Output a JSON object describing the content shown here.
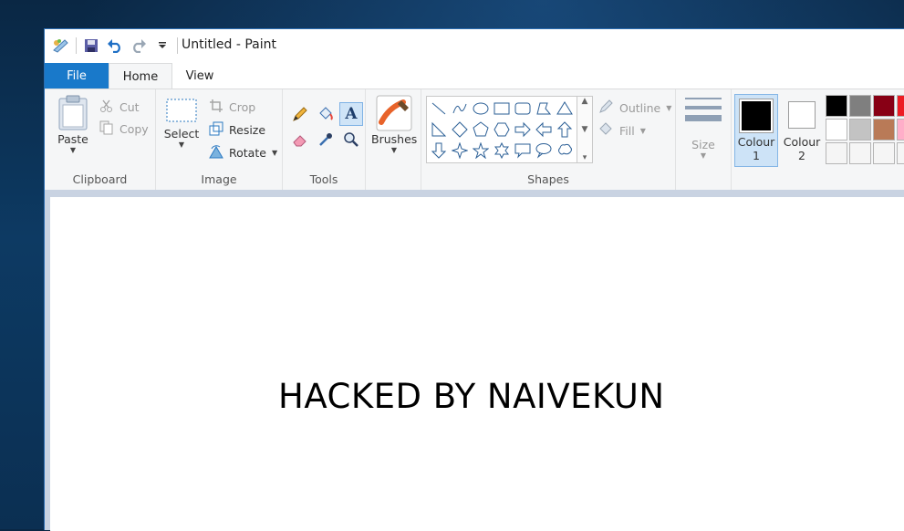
{
  "window": {
    "title": "Untitled - Paint"
  },
  "tabs": {
    "file": "File",
    "home": "Home",
    "view": "View"
  },
  "clipboard": {
    "paste": "Paste",
    "cut": "Cut",
    "copy": "Copy",
    "group": "Clipboard"
  },
  "image": {
    "select": "Select",
    "crop": "Crop",
    "resize": "Resize",
    "rotate": "Rotate",
    "group": "Image"
  },
  "tools": {
    "group": "Tools"
  },
  "brushes": {
    "label": "Brushes"
  },
  "shapes": {
    "outline": "Outline",
    "fill": "Fill",
    "group": "Shapes"
  },
  "size": {
    "label": "Size"
  },
  "colours": {
    "colour1_line1": "Colour",
    "colour1_line2": "1",
    "colour2_line1": "Colour",
    "colour2_line2": "2",
    "colour1": "#000000",
    "colour2": "#ffffff",
    "palette": [
      "#000000",
      "#7f7f7f",
      "#880015",
      "#ed1c24",
      "#ffffff",
      "#c3c3c3",
      "#b97a57",
      "#ffaec9",
      "#f5f5f5",
      "#f5f5f5",
      "#f5f5f5",
      "#f5f5f5"
    ]
  },
  "canvas": {
    "text": "HACKED BY NAIVEKUN"
  }
}
